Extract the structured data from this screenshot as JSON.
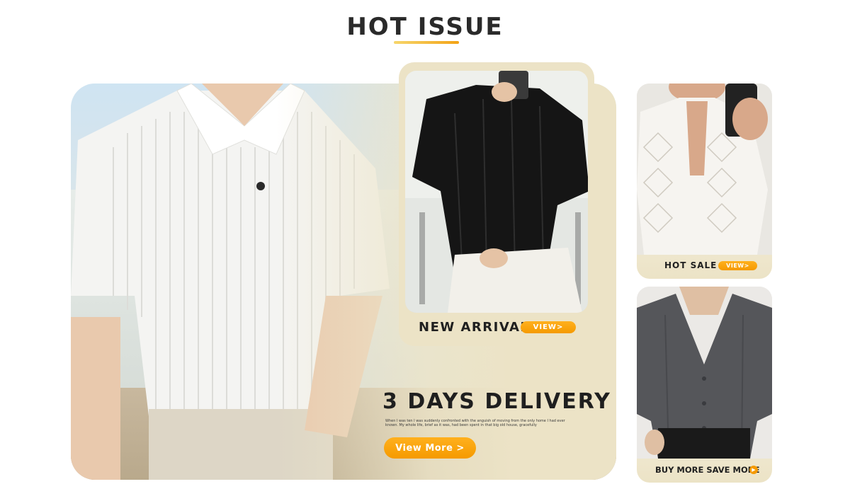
{
  "header": {
    "title": "HOT ISSUE"
  },
  "main_banner": {
    "title": "3 DAYS DELIVERY",
    "description": "When I was ten I was suddenly confronted with the anguish of moving from the only home I had ever known. My whole life, brief as it was, had been spent in that big old house, gracefully",
    "button_label": "View More >",
    "image_alt": "model-white-knit-polo-shirt"
  },
  "new_arrival": {
    "label": "NEW ARRIVAL",
    "button_label": "VIEW>",
    "image_alt": "model-black-fringe-shirt"
  },
  "hot_sale": {
    "label": "HOT SALE",
    "button_label": "VIEW>",
    "image_alt": "model-white-lace-shirt"
  },
  "buy_more": {
    "label": "BUY MORE SAVE MORE",
    "arrow_icon": "play-arrow-icon",
    "image_alt": "model-grey-vneck-shirt"
  },
  "colors": {
    "accent": "#f59a00",
    "cream": "#ece3c6",
    "text": "#1f1f1f"
  }
}
